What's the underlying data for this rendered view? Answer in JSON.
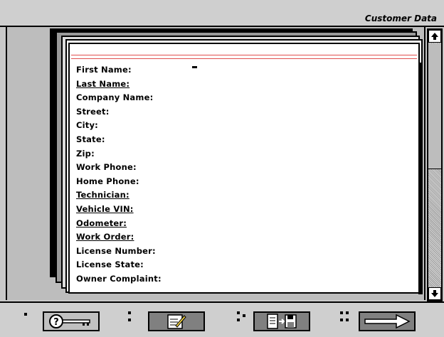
{
  "window": {
    "title": "Customer Data"
  },
  "form": {
    "fields": [
      {
        "label": "First Name:",
        "underlined": false
      },
      {
        "label": "Last Name:",
        "underlined": true
      },
      {
        "label": "Company Name:",
        "underlined": false
      },
      {
        "label": "Street:",
        "underlined": false
      },
      {
        "label": "City:",
        "underlined": false
      },
      {
        "label": "State:",
        "underlined": false
      },
      {
        "label": "Zip:",
        "underlined": false
      },
      {
        "label": "Work Phone:",
        "underlined": false
      },
      {
        "label": "Home Phone:",
        "underlined": false
      },
      {
        "label": "Technician:",
        "underlined": true
      },
      {
        "label": "Vehicle VIN:",
        "underlined": true
      },
      {
        "label": "Odometer:",
        "underlined": true
      },
      {
        "label": "Work Order:",
        "underlined": true
      },
      {
        "label": "License Number:",
        "underlined": false
      },
      {
        "label": "License State:",
        "underlined": false
      },
      {
        "label": "Owner Complaint:",
        "underlined": false
      }
    ]
  },
  "toolbar": {
    "buttons": [
      {
        "name": "help-key-button",
        "icon": "question-key-icon",
        "dots": 1
      },
      {
        "name": "edit-note-button",
        "icon": "notepad-pencil-icon",
        "dots": 2
      },
      {
        "name": "save-to-disk-button",
        "icon": "document-to-disk-icon",
        "dots": 3
      },
      {
        "name": "next-button",
        "icon": "right-arrow-icon",
        "dots": 4
      }
    ]
  },
  "colors": {
    "accent_line": "#e05050",
    "background": "#c8c8c8"
  }
}
